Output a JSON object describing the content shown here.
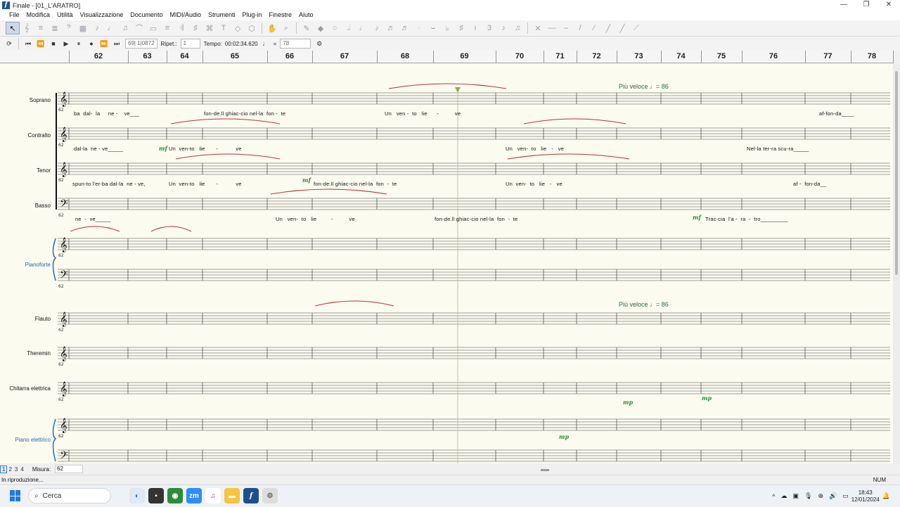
{
  "window": {
    "title": "Finale - [01_L'ARATRO]",
    "controls": [
      "—",
      "❐",
      "✕"
    ]
  },
  "menu": [
    "File",
    "Modifica",
    "Utilità",
    "Visualizzazione",
    "Documento",
    "MIDI/Audio",
    "Strumenti",
    "Plug-in",
    "Finestre",
    "Aiuto"
  ],
  "playback": {
    "position": "69| 1|0872",
    "repeat_label": "Ripet.:",
    "repeat_value": "1",
    "tempo_label": "Tempo:",
    "tempo_time": "00:02:34.620",
    "equals": "=",
    "tempo_value": "78"
  },
  "ruler": [
    "62",
    "63",
    "64",
    "65",
    "66",
    "67",
    "68",
    "69",
    "70",
    "71",
    "72",
    "73",
    "74",
    "75",
    "76",
    "77",
    "78"
  ],
  "instruments": [
    "Soprano",
    "Contralto",
    "Tenor",
    "Basso",
    "Pianoforte",
    "Flauto",
    "Theremin",
    "Chitarra elettrica",
    "Piano elettrico"
  ],
  "measure_start_label": "62",
  "tempo_marks": [
    "Più veloce ♩= 86",
    "Più veloce ♩= 86"
  ],
  "dynamics": [
    "mf",
    "mf",
    "mf",
    "mp",
    "mp",
    "mp"
  ],
  "lyrics": {
    "soprano": [
      "ba  dal-  la     ne -    ve___",
      "fon-de.ll ghiac-cio nel-la  fon -  te",
      "Un   ven -  to   lie      -          ve",
      "af-fon-da____"
    ],
    "contralto": [
      "dal-la  ne - ve_____",
      "Un  ven-to   lie       -           ve",
      "Un   ven-  to   lie   -   ve",
      "Nel-la ter-ra scu-ra_____"
    ],
    "tenor": [
      "spun-to l'er-ba dal-la  ne - ve,",
      "Un  ven-to   lie       -           ve",
      "fon-de.ll ghiac-cio nel-la  fon  -  te",
      "Un  ven-  to   lie   -   ve",
      "af -  fon-da__"
    ],
    "basso": [
      "ne  -  ve_____",
      "Un   ven-  to   lie         -          ve",
      "fon-de.ll ghiac-cio nel-la  fon  -  te",
      "Trac-cia  l'a -  ra  -  tro_________"
    ]
  },
  "bottom": {
    "pages": [
      "1",
      "2",
      "3",
      "4"
    ],
    "measure_label": "Misura:",
    "measure_value": "62"
  },
  "status": {
    "text": "In riproduzione...",
    "num": "NUM"
  },
  "taskbar": {
    "search_placeholder": "Cerca",
    "time": "18:43",
    "date": "12/01/2024"
  }
}
